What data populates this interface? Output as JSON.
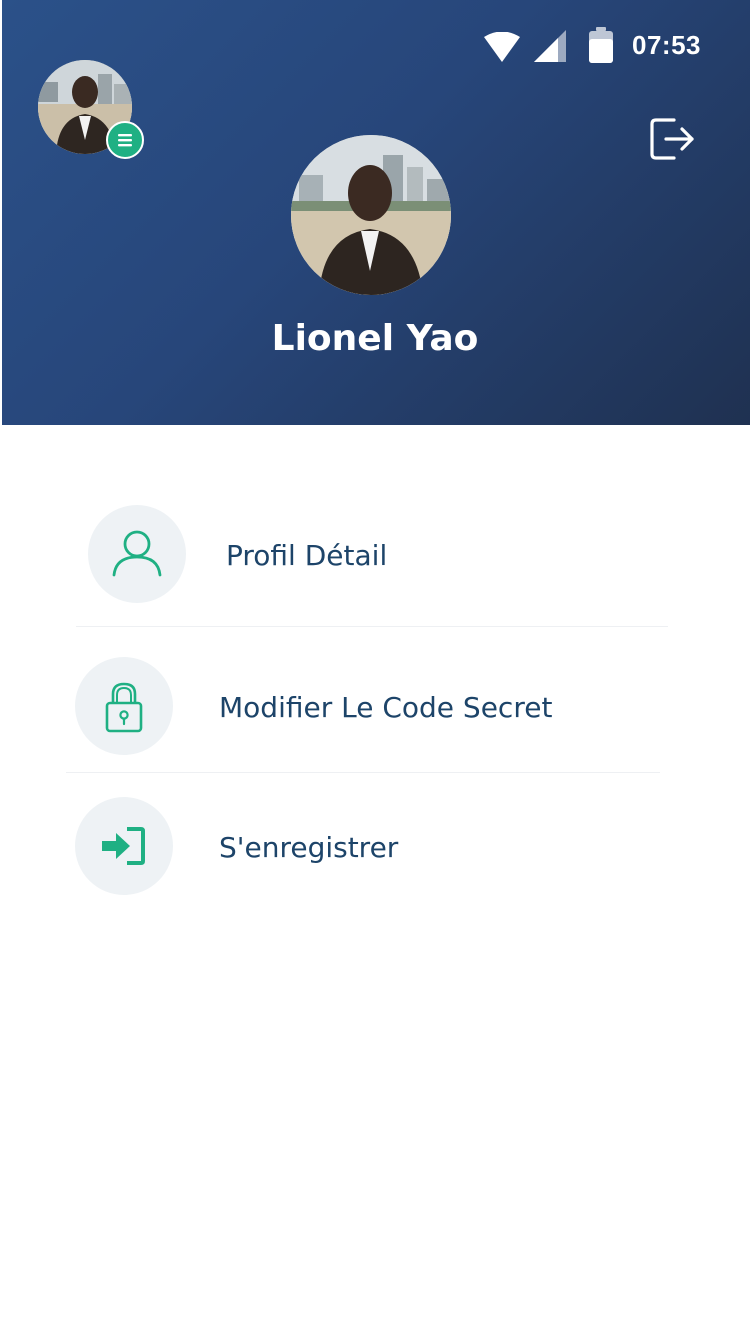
{
  "status_bar": {
    "time": "07:53",
    "icons": [
      "wifi-icon",
      "signal-icon",
      "battery-icon"
    ]
  },
  "header": {
    "user_name": "Lionel Yao",
    "logout_icon": "logout-icon",
    "menu_icon": "menu-icon"
  },
  "menu": {
    "items": [
      {
        "label": "Profil Détail",
        "icon": "user-icon"
      },
      {
        "label": "Modifier Le Code Secret",
        "icon": "lock-icon"
      },
      {
        "label": "S'enregistrer",
        "icon": "sign-in-icon"
      }
    ]
  },
  "colors": {
    "header_gradient_start": "#2b5189",
    "header_gradient_end": "#1f3151",
    "accent_green": "#1fb083",
    "label_text": "#1d4469",
    "icon_circle_bg": "#eef2f5"
  }
}
